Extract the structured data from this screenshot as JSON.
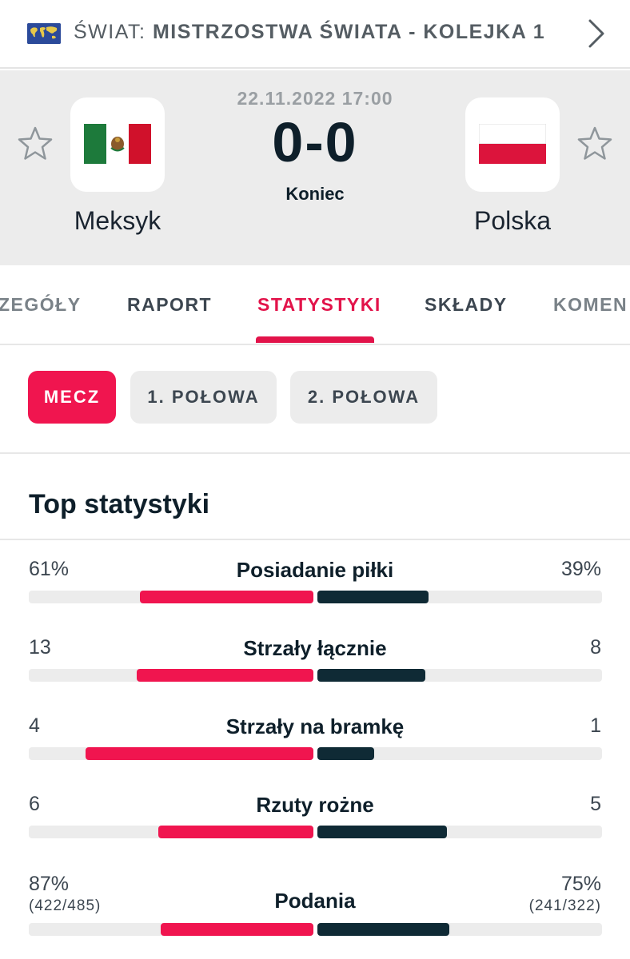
{
  "league": {
    "country": "ŚWIAT:",
    "competition": "MISTRZOSTWA ŚWIATA - KOLEJKA 1",
    "flag_icon": "world-map-flag",
    "arrow_icon": "chevron-right-icon"
  },
  "match": {
    "date": "22.11.2022 17:00",
    "score": "0-0",
    "status": "Koniec",
    "home": {
      "name": "Meksyk",
      "flag": "mexico-flag",
      "favorite_icon": "star-outline-icon"
    },
    "away": {
      "name": "Polska",
      "flag": "poland-flag",
      "favorite_icon": "star-outline-icon"
    }
  },
  "tabs": [
    {
      "label": "ZEGÓŁY"
    },
    {
      "label": "RAPORT"
    },
    {
      "label": "STATYSTYKI",
      "active": true
    },
    {
      "label": "SKŁADY"
    },
    {
      "label": "KOMEN"
    }
  ],
  "periods": [
    {
      "label": "MECZ",
      "active": true
    },
    {
      "label": "1. POŁOWA"
    },
    {
      "label": "2. POŁOWA"
    }
  ],
  "stats_section": {
    "title": "Top statystyki",
    "rows": [
      {
        "label": "Posiadanie piłki",
        "home": "61%",
        "away": "39%",
        "home_fraction": 0.61,
        "away_fraction": 0.39
      },
      {
        "label": "Strzały łącznie",
        "home": "13",
        "away": "8",
        "home_fraction": 0.62,
        "away_fraction": 0.38
      },
      {
        "label": "Strzały na bramkę",
        "home": "4",
        "away": "1",
        "home_fraction": 0.8,
        "away_fraction": 0.2
      },
      {
        "label": "Rzuty rożne",
        "home": "6",
        "away": "5",
        "home_fraction": 0.545,
        "away_fraction": 0.455
      },
      {
        "label": "Podania",
        "home": "87%",
        "away": "75%",
        "home_sub": "(422/485)",
        "away_sub": "(241/322)",
        "home_fraction": 0.537,
        "away_fraction": 0.463
      }
    ]
  },
  "colors": {
    "accent": "#f0154f",
    "away_bar": "#0f2a35",
    "header_bg": "#ececec"
  }
}
